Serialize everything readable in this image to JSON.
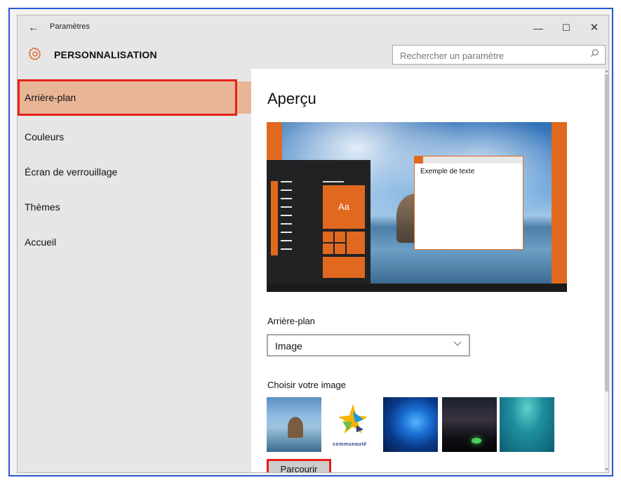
{
  "window": {
    "title": "Paramètres",
    "section": "PERSONNALISATION",
    "back_icon": "←",
    "minimize_icon": "—",
    "maximize_icon": "☐",
    "close_icon": "✕",
    "settings_icon": "gear-icon"
  },
  "search": {
    "placeholder": "Rechercher un paramètre",
    "icon": "search-icon"
  },
  "sidebar": {
    "items": [
      {
        "label": "Arrière-plan",
        "active": true
      },
      {
        "label": "Couleurs",
        "active": false
      },
      {
        "label": "Écran de verrouillage",
        "active": false
      },
      {
        "label": "Thèmes",
        "active": false
      },
      {
        "label": "Accueil",
        "active": false
      }
    ]
  },
  "main": {
    "preview_title": "Aperçu",
    "preview": {
      "sample_text": "Exemple de texte",
      "tile_label": "Aa"
    },
    "background_label": "Arrière-plan",
    "background_value": "Image",
    "choose_label": "Choisir votre image",
    "thumbnail_brand": "communauté",
    "browse_button": "Parcourir"
  },
  "colors": {
    "accent": "#e1691f",
    "highlight_outline": "#e52116",
    "sidebar_active": "#e8b597",
    "frame_border": "#2b59d6"
  }
}
